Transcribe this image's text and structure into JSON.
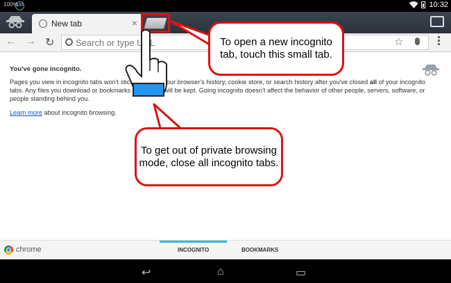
{
  "status_bar": {
    "left_label": "100%",
    "circle_label": "100",
    "time": "10:32"
  },
  "tab_strip": {
    "tabs": [
      {
        "title": "New tab",
        "icon": "globe-icon"
      }
    ],
    "close_glyph": "×",
    "new_tab_icon": "new-incognito-tab-icon",
    "tab_switcher_icon": "tab-switcher-icon"
  },
  "toolbar": {
    "back_glyph": "←",
    "forward_glyph": "→",
    "reload_glyph": "↻",
    "search_placeholder": "Search or type URL",
    "star_glyph": "☆"
  },
  "content": {
    "heading": "You've gone incognito.",
    "paragraph_part1": "Pages you view in incognito tabs won't stick around in your browser's history, cookie store, or search history after you've closed ",
    "paragraph_bold": "all",
    "paragraph_part2": " of your incognito tabs. Any files you download or bookmarks you create will be kept. Going incognito doesn't affect the behavior of other people, servers, software, or people standing behind you.",
    "learn_more_link": "Learn more",
    "learn_more_rest": " about incognito browsing."
  },
  "bottom_bar": {
    "brand": "chrome",
    "tabs": [
      "INCOGNITO",
      "BOOKMARKS"
    ],
    "active_tab": "INCOGNITO"
  },
  "nav_bar": {
    "back_glyph": "↩",
    "home_glyph": "⌂",
    "recents_glyph": "▭"
  },
  "callouts": {
    "new_tab_text": "To open a new incognito tab, touch this small tab.",
    "close_text": "To get out of private browsing mode, close all incognito tabs."
  },
  "colors": {
    "callout_border": "#dd1111",
    "link": "#1155cc",
    "active_tab_indicator": "#33b5e5",
    "tabstrip": "#2b323b"
  }
}
